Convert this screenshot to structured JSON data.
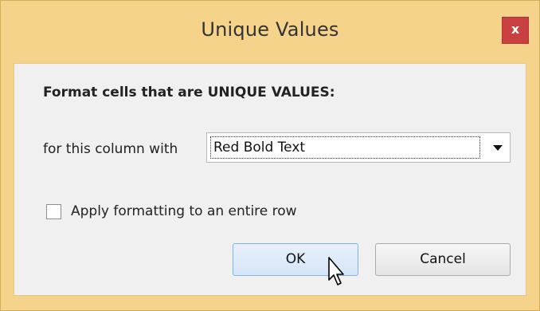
{
  "window": {
    "title": "Unique Values",
    "close_label": "x"
  },
  "dialog": {
    "heading": "Format cells that are UNIQUE VALUES:",
    "column_label": "for this column with",
    "format_select": {
      "value": "Red Bold Text"
    },
    "apply_row": {
      "label": "Apply formatting to an entire row",
      "checked": false
    }
  },
  "buttons": {
    "ok": "OK",
    "cancel": "Cancel"
  },
  "colors": {
    "title_bar": "#f6d38a",
    "close_button": "#c94041",
    "client_bg": "#f0f0f0",
    "ok_button_border": "#7eb4ea"
  },
  "icons": {
    "close": "close-icon",
    "dropdown": "chevron-down-icon",
    "cursor": "mouse-pointer-icon"
  }
}
